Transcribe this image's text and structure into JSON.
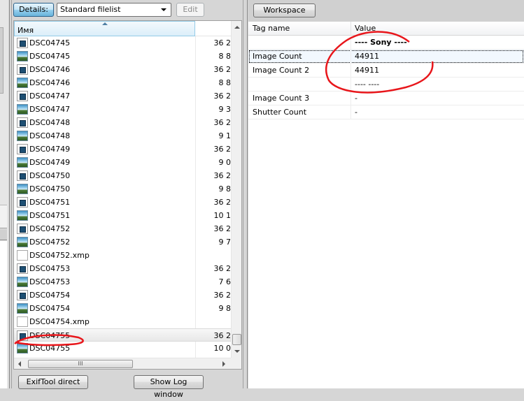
{
  "left_toolbar": {
    "details_button": "Details:",
    "filelist_select": "Standard filelist",
    "edit_button": "Edit"
  },
  "filelist": {
    "columns": {
      "name": "Имя",
      "size": ""
    },
    "rows": [
      {
        "name": "DSC04745",
        "size": "36 2",
        "type": "raw"
      },
      {
        "name": "DSC04745",
        "size": "8 8",
        "type": "image"
      },
      {
        "name": "DSC04746",
        "size": "36 2",
        "type": "raw"
      },
      {
        "name": "DSC04746",
        "size": "8 8",
        "type": "image"
      },
      {
        "name": "DSC04747",
        "size": "36 2",
        "type": "raw"
      },
      {
        "name": "DSC04747",
        "size": "9 3",
        "type": "image"
      },
      {
        "name": "DSC04748",
        "size": "36 2",
        "type": "raw"
      },
      {
        "name": "DSC04748",
        "size": "9 1",
        "type": "image"
      },
      {
        "name": "DSC04749",
        "size": "36 2",
        "type": "raw"
      },
      {
        "name": "DSC04749",
        "size": "9 0",
        "type": "image"
      },
      {
        "name": "DSC04750",
        "size": "36 2",
        "type": "raw"
      },
      {
        "name": "DSC04750",
        "size": "9 8",
        "type": "image"
      },
      {
        "name": "DSC04751",
        "size": "36 2",
        "type": "raw"
      },
      {
        "name": "DSC04751",
        "size": "10 1",
        "type": "image"
      },
      {
        "name": "DSC04752",
        "size": "36 2",
        "type": "raw"
      },
      {
        "name": "DSC04752",
        "size": "9 7",
        "type": "image"
      },
      {
        "name": "DSC04752.xmp",
        "size": "",
        "type": "xmp"
      },
      {
        "name": "DSC04753",
        "size": "36 2",
        "type": "raw"
      },
      {
        "name": "DSC04753",
        "size": "7 6",
        "type": "image"
      },
      {
        "name": "DSC04754",
        "size": "36 2",
        "type": "raw"
      },
      {
        "name": "DSC04754",
        "size": "9 8",
        "type": "image"
      },
      {
        "name": "DSC04754.xmp",
        "size": "",
        "type": "xmp"
      },
      {
        "name": "DSC04755",
        "size": "36 2",
        "type": "raw",
        "selected": true
      },
      {
        "name": "DSC04755",
        "size": "10 0",
        "type": "image"
      }
    ],
    "hscroll_grip": "III"
  },
  "bottom_buttons": {
    "exiftool_direct": "ExifTool direct",
    "show_log": "Show Log window"
  },
  "right_toolbar": {
    "workspace_button": "Workspace"
  },
  "metadata": {
    "columns": {
      "tag": "Tag name",
      "value": "Value"
    },
    "rows": [
      {
        "tag": "",
        "value": "---- Sony ----",
        "group": true
      },
      {
        "tag": "Image Count",
        "value": "44911",
        "focused": true
      },
      {
        "tag": "Image Count 2",
        "value": "44911"
      },
      {
        "tag": "",
        "value": "----  ----",
        "group": false
      },
      {
        "tag": "Image Count 3",
        "value": "-"
      },
      {
        "tag": "Shutter Count",
        "value": "-"
      }
    ]
  },
  "annotation_color": "#e8161b"
}
